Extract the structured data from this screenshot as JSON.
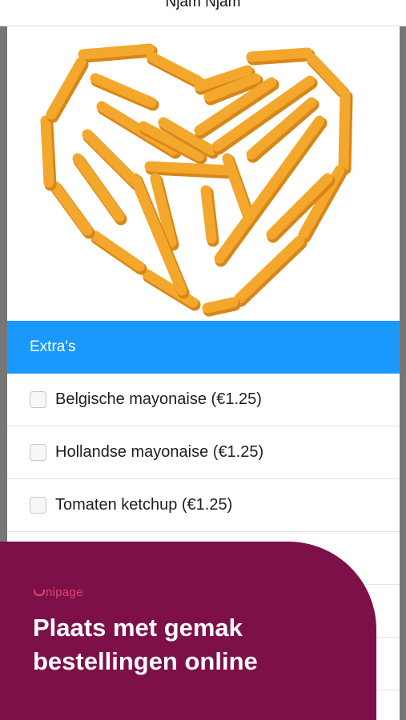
{
  "header": {
    "title": "Njam Njam"
  },
  "hero": {
    "image_alt": "Fries arranged in a heart shape"
  },
  "extras": {
    "title": "Extra's",
    "options": [
      {
        "label": "Belgische mayonaise (€1.25)",
        "checked": false
      },
      {
        "label": "Hollandse mayonaise (€1.25)",
        "checked": false
      },
      {
        "label": "Tomaten ketchup (€1.25)",
        "checked": false
      },
      {
        "label": "",
        "checked": false
      },
      {
        "label": "",
        "checked": false
      },
      {
        "label": "",
        "checked": false
      }
    ]
  },
  "promo": {
    "brand": "nipage",
    "headline_line1": "Plaats met gemak",
    "headline_line2": "bestellingen online"
  },
  "colors": {
    "accent_blue": "#1a98fc",
    "promo_bg": "#7d1049",
    "brand_red": "#e0436b",
    "fries": "#f3a72c"
  }
}
